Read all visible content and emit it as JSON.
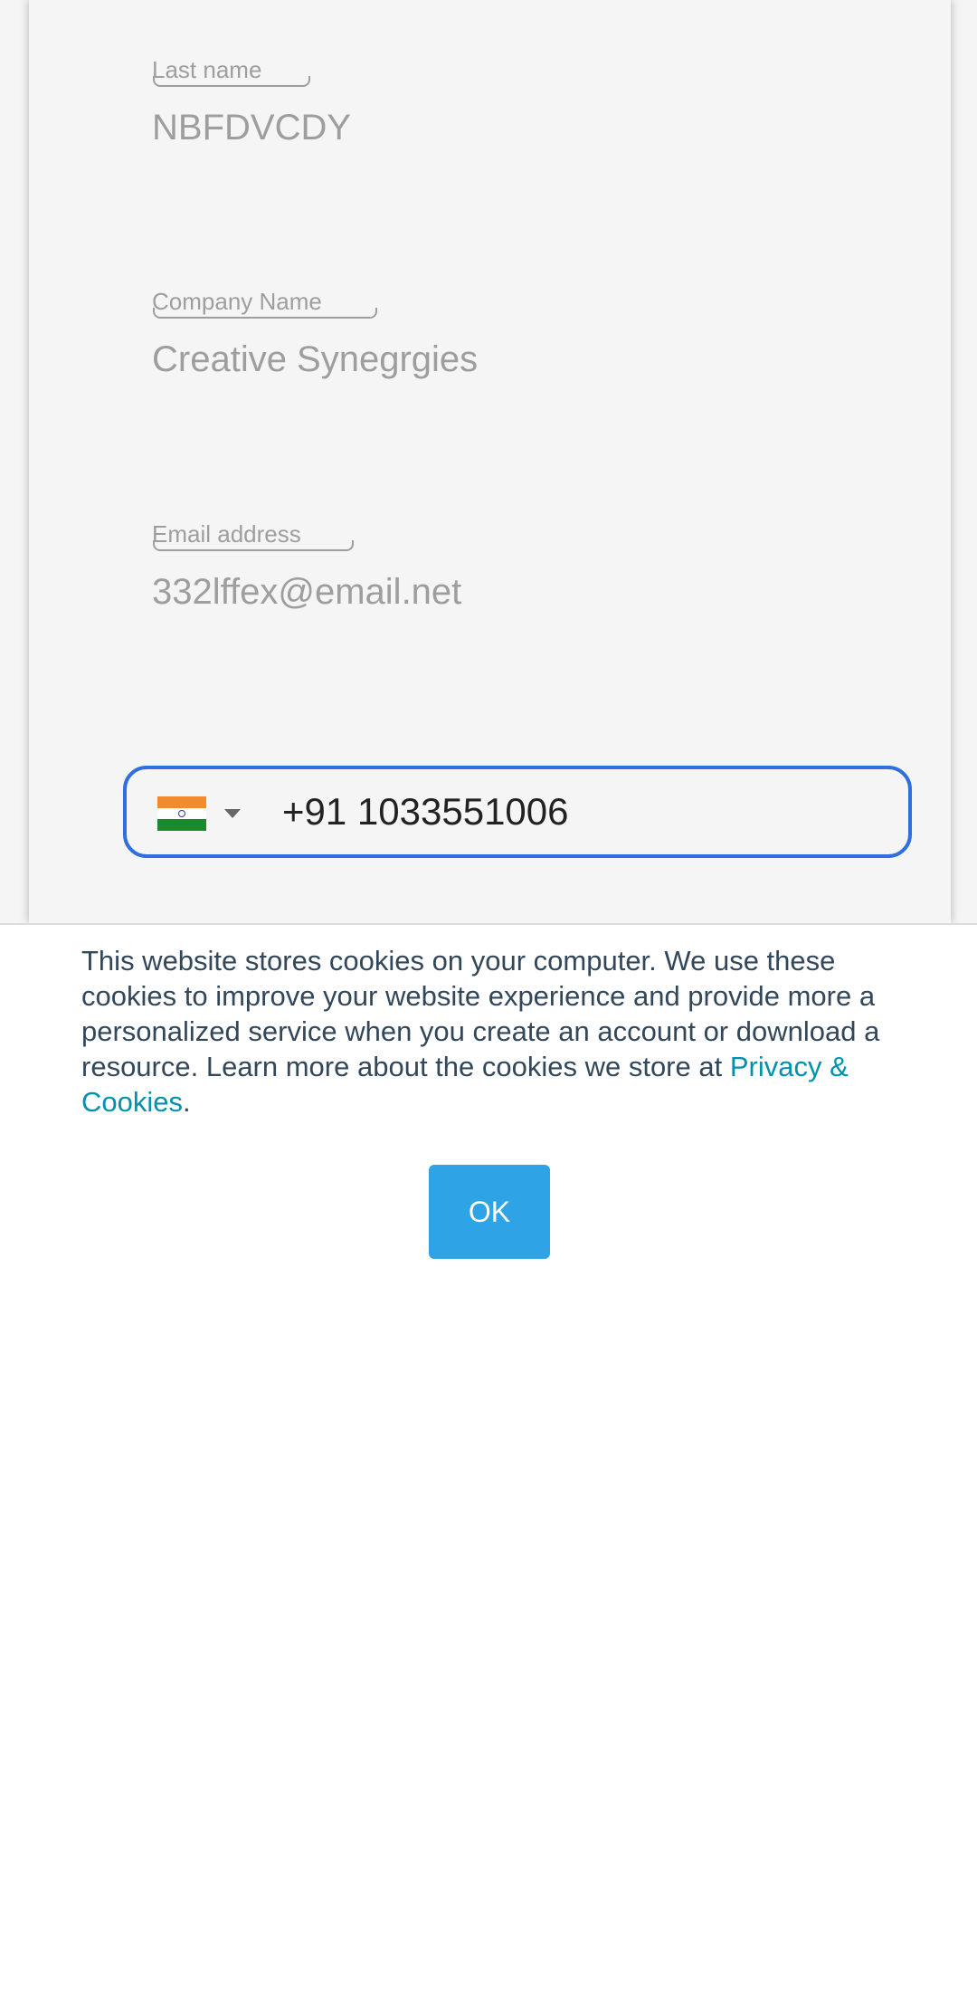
{
  "form": {
    "last_name": {
      "label": "Last name",
      "value": "NBFDVCDY"
    },
    "company_name": {
      "label": "Company Name",
      "value": "Creative Synegrgies"
    },
    "email": {
      "label": "Email address",
      "value": "332lffex@email.net"
    },
    "phone": {
      "country_flag": "india-flag-icon",
      "value": "+91 1033551006"
    }
  },
  "cookie_banner": {
    "text": "This website stores cookies on your computer. We use these cookies to improve your website experience and provide more a personalized service when you create an account or download a resource. Learn more about the cookies we store at ",
    "link_text": "Privacy & Cookies",
    "text_end": ".",
    "ok_label": "OK"
  },
  "colors": {
    "focus_border": "#2f6fe0",
    "link": "#0091ae",
    "ok_button": "#2ea3e6",
    "banner_text": "#33475b"
  }
}
